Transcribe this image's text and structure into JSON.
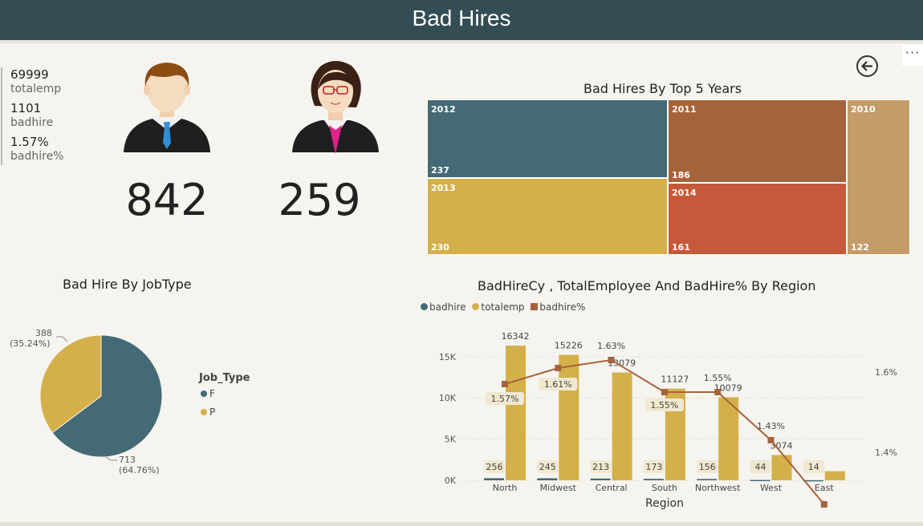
{
  "header": {
    "title": "Bad Hires"
  },
  "more_label": "···",
  "kpis": [
    {
      "value": "69999",
      "label": "totalemp"
    },
    {
      "value": "1101",
      "label": "badhire"
    },
    {
      "value": "1.57%",
      "label": "badhire%"
    }
  ],
  "gender_cards": [
    {
      "icon": "male-employee-icon",
      "count": "842"
    },
    {
      "icon": "female-employee-icon",
      "count": "259"
    }
  ],
  "treemap": {
    "title": "Bad Hires By Top 5 Years",
    "tiles": [
      {
        "year": "2012",
        "value": "237",
        "color": "#436a75"
      },
      {
        "year": "2011",
        "value": "186",
        "color": "#a5633b"
      },
      {
        "year": "2010",
        "value": "122",
        "color": "#c49c6a"
      },
      {
        "year": "2013",
        "value": "230",
        "color": "#d4b04a"
      },
      {
        "year": "2014",
        "value": "161",
        "color": "#c55a3a"
      }
    ]
  },
  "pie": {
    "title": "Bad Hire By JobType",
    "legend_title": "Job_Type",
    "slices": [
      {
        "name": "F",
        "value": 713,
        "label": "713",
        "pct": "(64.76%)",
        "color": "#436a75"
      },
      {
        "name": "P",
        "value": 388,
        "label": "388",
        "pct": "(35.24%)",
        "color": "#d4b04a"
      }
    ]
  },
  "chart_data": {
    "type": "bar",
    "title": "BadHireCy , TotalEmployee And BadHire% By Region",
    "xlabel": "Region",
    "ylabel": "",
    "categories": [
      "North",
      "Midwest",
      "Central",
      "South",
      "Northwest",
      "West",
      "East"
    ],
    "y_ticks": [
      "15K",
      "10K",
      "5K",
      "0K"
    ],
    "y2_ticks": [
      "1.6%",
      "1.4%"
    ],
    "ylim": [
      0,
      18000
    ],
    "y2lim": [
      1.33,
      1.7
    ],
    "legend_position": "top-left",
    "series": [
      {
        "name": "badhire",
        "kind": "bar",
        "color": "#436a75",
        "values": [
          256,
          245,
          213,
          173,
          156,
          44,
          14
        ],
        "labels": [
          "256",
          "245",
          "213",
          "173",
          "156",
          "44",
          "14"
        ]
      },
      {
        "name": "totalemp",
        "kind": "bar",
        "color": "#d4b04a",
        "values": [
          16342,
          15226,
          13079,
          11127,
          10079,
          3074,
          1105
        ],
        "labels": [
          "16342",
          "15226",
          "13079",
          "11127",
          "10079",
          "3074",
          ""
        ]
      },
      {
        "name": "badhire%",
        "kind": "line",
        "color": "#a5633b",
        "values": [
          1.57,
          1.61,
          1.63,
          1.55,
          1.55,
          1.43,
          1.27
        ],
        "labels": [
          "1.57%",
          "1.61%",
          "1.63%",
          "1.55%",
          "1.55%",
          "1.43%",
          ""
        ]
      }
    ]
  }
}
